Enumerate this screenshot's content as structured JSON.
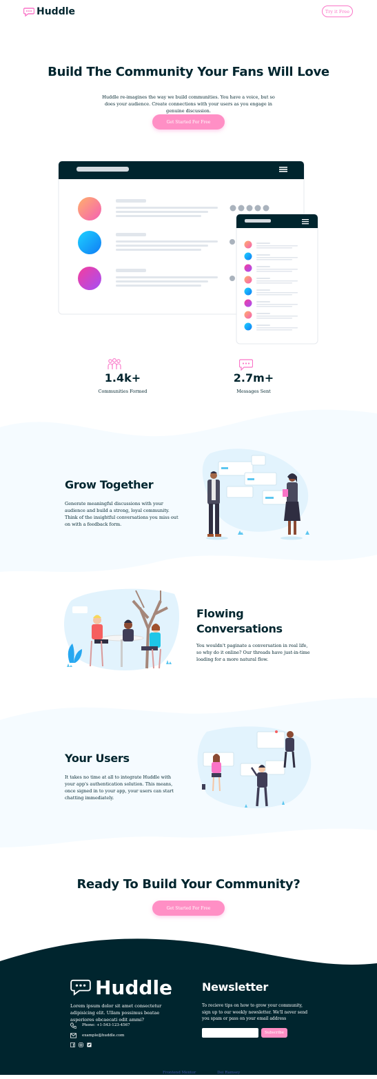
{
  "header": {
    "logo_text": "Huddle",
    "cta_label": "Try it Free"
  },
  "hero": {
    "title": "Build The Community Your Fans Will Love",
    "description": "Huddle re-imagines the way we build communities. You have a voice, but so does your audience. Create connections with your users as you engage in genuine discussion.",
    "cta_label": "Get Started For Free"
  },
  "stats": [
    {
      "value": "1.4k+",
      "label": "Communities Formed",
      "icon": "users-icon"
    },
    {
      "value": "2.7m+",
      "label": "Messages Sent",
      "icon": "chat-bubble-icon"
    }
  ],
  "features": [
    {
      "title": "Grow Together",
      "description": "Generate meaningful discussions with your audience and build a strong, loyal community. Think of the insightful conversations you miss out on with a feedback form."
    },
    {
      "title": "Flowing Conversations",
      "description": "You wouldn't paginate a conversation in real life, so why do it online? Our threads have just-in-time loading for a more natural flow."
    },
    {
      "title": "Your Users",
      "description": "It takes no time at all to integrate Huddle with your app's authentication solution. This means, once signed in to your app, your users can start chatting immediately."
    }
  ],
  "cta": {
    "title": "Ready To Build Your Community?",
    "button_label": "Get Started For Free"
  },
  "footer": {
    "logo_text": "Huddle",
    "description": "Lorem ipsum dolor sit amet consectetur adipisicing elit. Ullam possimus beatae asperiores obcaecati odit ammi?",
    "phone": "Phone: +1-543-123-4567",
    "email": "example@huddle.com",
    "social": [
      "facebook-icon",
      "instagram-icon",
      "twitter-icon"
    ],
    "newsletter_title": "Newsletter",
    "newsletter_text": "To recieve tips on how to grow your community, sign up to our weekly newsletter. We'll never send you spam or pass on your email address",
    "email_placeholder": "",
    "subscribe_label": "Subscribe"
  },
  "attribution": {
    "prefix": "Challenge by",
    "fm_link": "Frontend Mentor",
    "middle": ". Coded by",
    "author_link": "Dei Ramsey",
    "suffix": "."
  },
  "colors": {
    "dark": "#00252e",
    "pink": "#fa74c7",
    "light_blue_bg": "#f5fbff"
  }
}
